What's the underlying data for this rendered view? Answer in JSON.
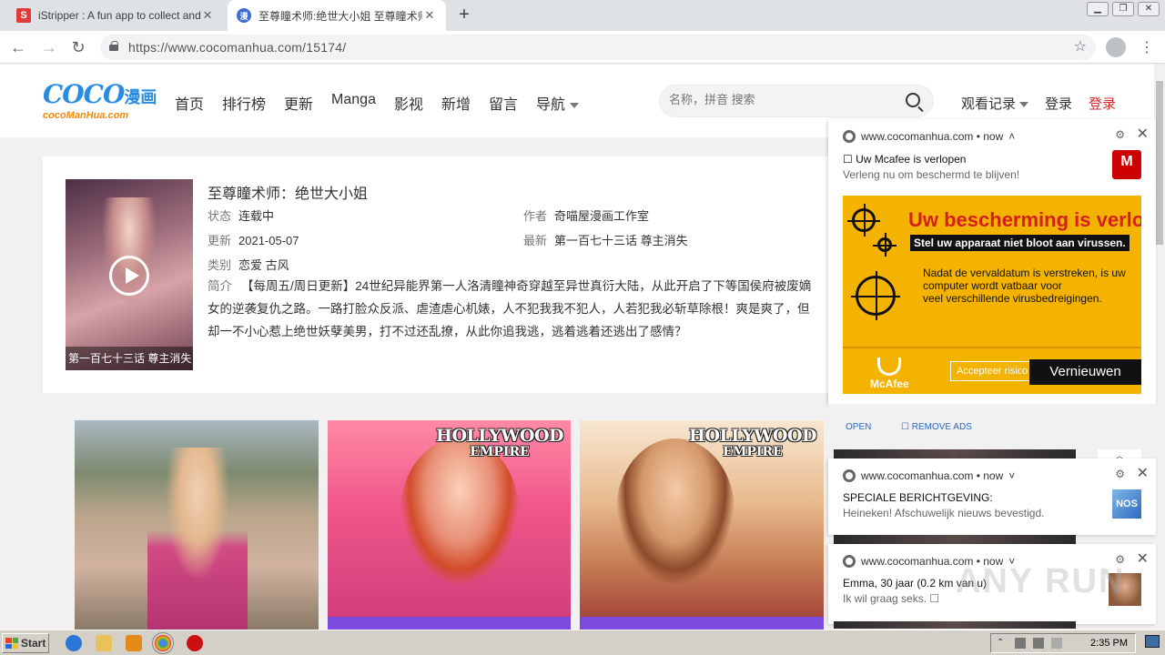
{
  "browser": {
    "tabs": [
      {
        "title": "iStripper : A fun app to collect and w",
        "favicon": "s-favicon"
      },
      {
        "title": "至尊瞳术师:绝世大小姐 至尊瞳术师",
        "favicon": "manhua-favicon"
      }
    ],
    "new_tab": "+",
    "url": "https://www.cocomanhua.com/15174/"
  },
  "site": {
    "logo_main": "COCO",
    "logo_cn": "漫画",
    "logo_sub": "cocoManHua.com",
    "nav": [
      "首页",
      "排行榜",
      "更新",
      "Manga",
      "影视",
      "新增",
      "留言",
      "导航"
    ],
    "search_placeholder": "名称，拼音 搜索",
    "history": "观看记录",
    "login": "登录",
    "register": "登录"
  },
  "comic": {
    "title": "至尊瞳术师：绝世大小姐",
    "status_label": "状态",
    "status": "连载中",
    "author_label": "作者",
    "author": "奇喵屋漫画工作室",
    "updated_label": "更新",
    "updated": "2021-05-07",
    "latest_label": "最新",
    "latest": "第一百七十三话 尊主消失",
    "genre_label": "类别",
    "genre": "恋爱 古风",
    "intro_label": "简介",
    "intro_lines": [
      "【每周五/周日更新】24世纪异能界第一人洛清瞳神奇穿越至异世真衍大陆，从此开启了下等国侯府被废嫡",
      "女的逆袭复仇之路。一路打脸众反派、虐渣虐心机婊，人不犯我我不犯人，人若犯我必斩草除根！爽是爽了，但",
      "却一不小心惹上绝世妖孽美男，打不过还乱撩，从此你追我逃，逃着逃着还逃出了感情？"
    ],
    "cover_caption": "第一百七十三话 尊主消失"
  },
  "thumbs": [
    {
      "brand_top": "",
      "brand_bottom": ""
    },
    {
      "brand_top": "HOLLYWOOD",
      "brand_bottom": "EMPIRE"
    },
    {
      "brand_top": "HOLLYWOOD",
      "brand_bottom": "EMPIRE"
    }
  ],
  "notifications": [
    {
      "source": "www.cocomanhua.com • now",
      "title": "☐ Uw Mcafee is verlopen",
      "body": "Verleng nu om beschermd te blijven!",
      "ad": {
        "headline": "Uw bescherming is verlopen!",
        "strap": "Stel uw apparaat niet bloot aan virussen.",
        "para": [
          "Nadat de vervaldatum is verstreken, is uw",
          "computer wordt vatbaar voor",
          "veel verschillende virusbedreigingen."
        ],
        "brand": "McAfee",
        "accept": "Accepteer risico",
        "renew": "Vernieuwen"
      },
      "open": "OPEN",
      "remove": "☐ REMOVE ADS"
    },
    {
      "source": "www.cocomanhua.com • now",
      "title": "SPECIALE BERICHTGEVING:",
      "body": "Heineken! Afschuwelijk nieuws bevestigd.",
      "badge": "NOS"
    },
    {
      "source": "www.cocomanhua.com • now",
      "title": "Emma, 30 jaar (0.2 km van u)",
      "body": "Ik wil graag seks. ☐"
    }
  ],
  "watermark": "ANY RUN",
  "taskbar": {
    "start": "Start",
    "time": "2:35 PM"
  },
  "colors": {
    "accent_blue": "#2a8ce0",
    "login_red": "#e12828",
    "mcafee_yellow": "#f5b301",
    "mcafee_red": "#d3201d"
  }
}
